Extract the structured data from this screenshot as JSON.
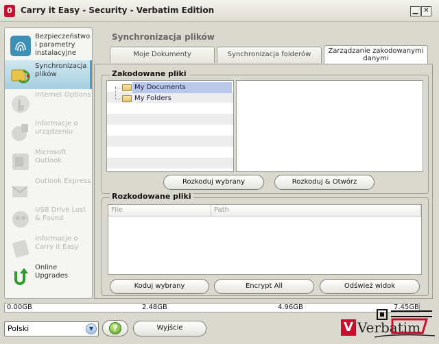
{
  "window": {
    "title": "Carry it Easy - Security - Verbatim Edition",
    "app_icon_glyph": "0"
  },
  "sidebar": {
    "items": [
      {
        "label": "Bezpieczeństwo i parametry instalacyjne",
        "icon": "fingerprint-icon",
        "state": "enabled"
      },
      {
        "label": "Synchronizacja plików",
        "icon": "sync-folders-icon",
        "state": "active"
      },
      {
        "label": "Internet Options",
        "icon": "internet-hand-icon",
        "state": "disabled"
      },
      {
        "label": "Informacje o urządzeniu",
        "icon": "device-info-icon",
        "state": "disabled"
      },
      {
        "label": "Microsoft Outlook",
        "icon": "outlook-icon",
        "state": "disabled"
      },
      {
        "label": "Outlook Express",
        "icon": "outlook-express-icon",
        "state": "disabled"
      },
      {
        "label": "USB Drive Lost & Found",
        "icon": "usb-lost-found-icon",
        "state": "disabled"
      },
      {
        "label": "Informacje o Carry it Easy",
        "icon": "about-icon",
        "state": "disabled"
      },
      {
        "label": "Online Upgrades",
        "icon": "upgrade-arrow-icon",
        "state": "enabled"
      }
    ]
  },
  "main": {
    "heading": "Synchronizacja plików",
    "tabs": [
      {
        "label": "Moje Dokumenty",
        "active": false
      },
      {
        "label": "Synchronizacja folderów",
        "active": false
      },
      {
        "label": "Zarządzanie zakodowanymi danymi",
        "active": true
      }
    ],
    "encoded": {
      "title": "Zakodowane pliki",
      "tree": [
        {
          "label": "My Documents",
          "selected": true
        },
        {
          "label": "My Folders",
          "selected": false
        }
      ],
      "buttons": {
        "decode_selected": "Rozkoduj wybrany",
        "decode_open": "Rozkoduj & Otwórz"
      }
    },
    "decoded": {
      "title": "Rozkodowane pliki",
      "columns": [
        "File",
        "Path"
      ],
      "rows": [],
      "buttons": {
        "encode_selected": "Koduj wybrany",
        "encrypt_all": "Encrypt All",
        "refresh": "Odśwież widok"
      }
    }
  },
  "storage": {
    "labels": [
      "0.00GB",
      "2.48GB",
      "4.96GB",
      "7.45GB"
    ],
    "used_fraction": 0
  },
  "footer": {
    "language": "Polski",
    "help_glyph": "?",
    "exit_label": "Wyjście",
    "logo_text": "Verbatim",
    "logo_mark": "V"
  },
  "colors": {
    "accent": "#4b9ec2",
    "brand_red": "#c8102e"
  }
}
